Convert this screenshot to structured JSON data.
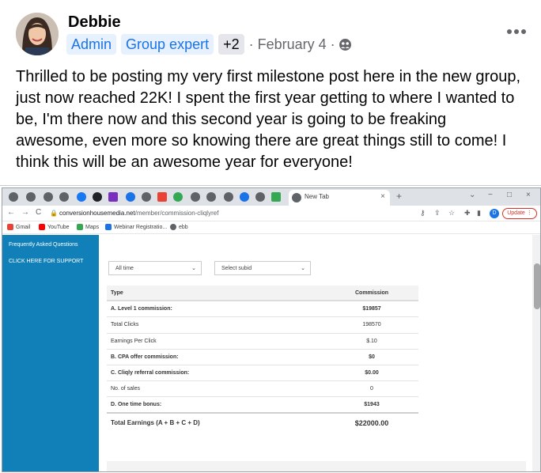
{
  "post": {
    "author": "Debbie",
    "badges": [
      "Admin",
      "Group expert"
    ],
    "badge_more": "+2",
    "date": "· February 4 ·",
    "text": "Thrilled to be posting my very first milestone post here in the new group, just now reached 22K!  I spent the first year getting to where I wanted to be, I'm there now and this second year is going to be freaking awesome, even more so knowing there are great things still to come!  I think this will be an awesome year for everyone!"
  },
  "browser": {
    "active_tab_title": "New Tab",
    "tab_close": "×",
    "tab_add": "+",
    "window_controls": [
      "⌄",
      "−",
      "□",
      "×"
    ],
    "nav": [
      "←",
      "→",
      "C"
    ],
    "url_host": "conversionhousemedia.net",
    "url_path": "/member/commission-cliqlyref",
    "profile_initial": "D",
    "update_label": "Update",
    "bookmarks": [
      {
        "label": "Gmail",
        "color": "#ea4335"
      },
      {
        "label": "YouTube",
        "color": "#ff0000"
      },
      {
        "label": "Maps",
        "color": "#34a853"
      },
      {
        "label": "Webinar Registratio...",
        "color": "#1a73e8"
      },
      {
        "label": "ebb",
        "color": "#5f6368"
      }
    ]
  },
  "sidebar": {
    "links": [
      "Frequently Asked Questions",
      "CLICK HERE FOR SUPPORT"
    ],
    "color": "#1280b8"
  },
  "filters": {
    "period": "All time",
    "subid": "Select subid"
  },
  "commission_table": {
    "headers": [
      "Type",
      "Commission"
    ],
    "rows": [
      {
        "type": "A. Level 1 commission:",
        "value": "$19857",
        "bold": true
      },
      {
        "type": "Total Clicks",
        "value": "198570",
        "bold": false
      },
      {
        "type": "Earnings Per Click",
        "value": "$.10",
        "bold": false
      },
      {
        "type": "B. CPA offer commission:",
        "value": "$0",
        "bold": true
      },
      {
        "type": "C. Cliqly referral commission:",
        "value": "$0.00",
        "bold": true
      },
      {
        "type": "No. of sales",
        "value": "0",
        "bold": false
      },
      {
        "type": "D. One time bonus:",
        "value": "$1943",
        "bold": true
      }
    ],
    "total_label": "Total Earnings (A + B + C + D)",
    "total_value": "$22000.00"
  }
}
